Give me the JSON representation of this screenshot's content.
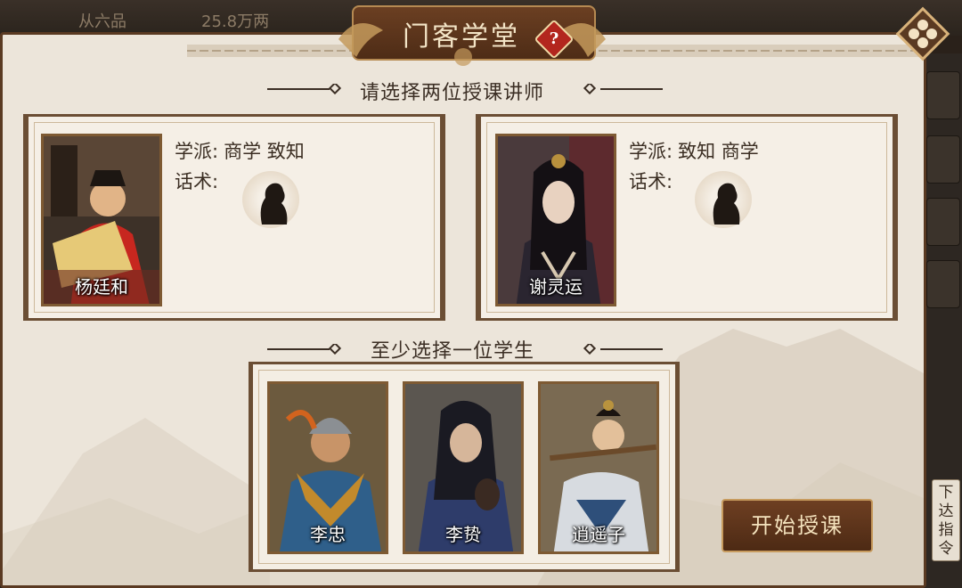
{
  "background": {
    "rank": "从六品",
    "money": "25.8万两"
  },
  "title": "门客学堂",
  "help_icon": "question-icon",
  "close_icon": "close-icon",
  "teacher_section_title": "请选择两位授课讲师",
  "teachers": [
    {
      "name": "杨廷和",
      "school_label": "学派:",
      "schools": "商学  致知",
      "speech_label": "话术:"
    },
    {
      "name": "谢灵运",
      "school_label": "学派:",
      "schools": "致知  商学",
      "speech_label": "话术:"
    }
  ],
  "student_section_title": "至少选择一位学生",
  "students": [
    {
      "name": "李忠"
    },
    {
      "name": "李贽"
    },
    {
      "name": "逍遥子"
    }
  ],
  "start_button": "开始授课",
  "command_button": "下达指令",
  "colors": {
    "panel_bg": "#ece5da",
    "frame_brown": "#6b4e34",
    "button_brown": "#5c3319",
    "gold_text": "#f4e2bd"
  }
}
